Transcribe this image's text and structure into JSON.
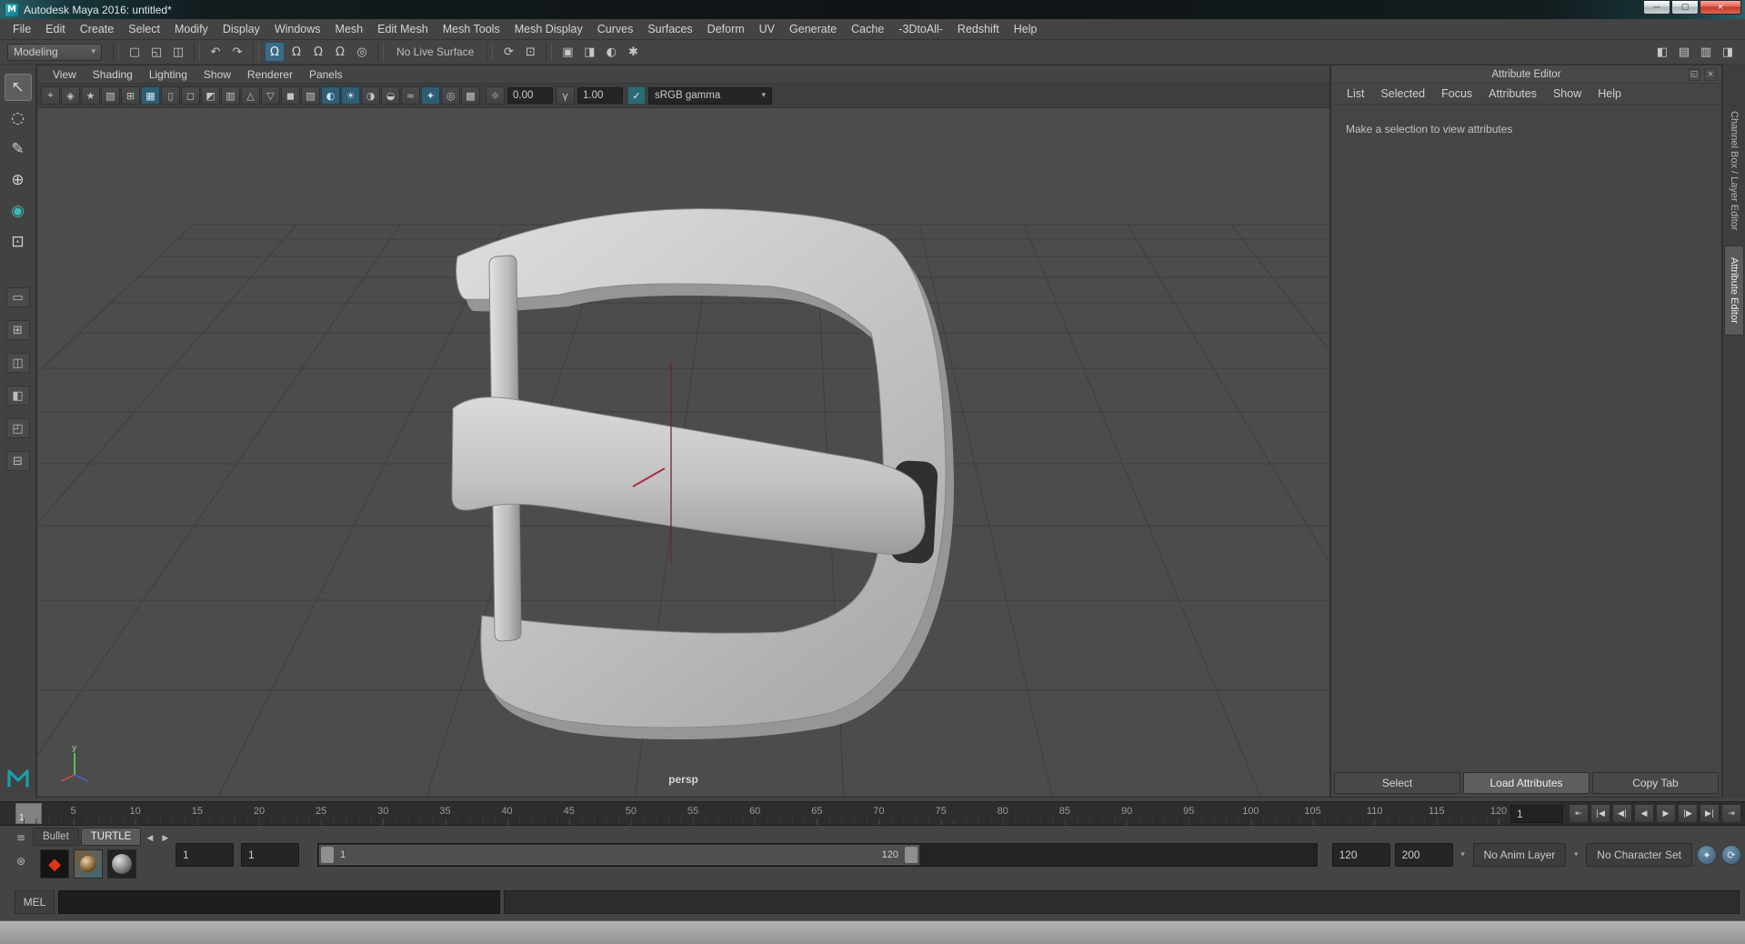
{
  "colors": {
    "accent_blue": "#3c6b86",
    "viewport_active_teal": "#2f5d74",
    "close_red": "#c23b28",
    "maya_teal": "#19a0a8",
    "viewport_bg": "#4c4c4c",
    "timeline_bg": "#2d2d2d"
  },
  "window": {
    "title": "Autodesk Maya 2016: untitled*",
    "controls": [
      {
        "name": "minimize-button",
        "glyph": "—"
      },
      {
        "name": "maximize-button",
        "glyph": "▢"
      },
      {
        "name": "close-button",
        "glyph": "×"
      }
    ]
  },
  "menu_bar": {
    "items": [
      "File",
      "Edit",
      "Create",
      "Select",
      "Modify",
      "Display",
      "Windows",
      "Mesh",
      "Edit Mesh",
      "Mesh Tools",
      "Mesh Display",
      "Curves",
      "Surfaces",
      "Deform",
      "UV",
      "Generate",
      "Cache",
      "-3DtoAll-",
      "Redshift",
      "Help"
    ]
  },
  "status_line": {
    "menuset": {
      "label": "Modeling"
    },
    "file_icons": [
      {
        "name": "new-scene-icon",
        "glyph": "▢"
      },
      {
        "name": "open-scene-icon",
        "glyph": "◱"
      },
      {
        "name": "save-scene-icon",
        "glyph": "◫"
      }
    ],
    "edit_icons": [
      {
        "name": "undo-icon",
        "glyph": "↶"
      },
      {
        "name": "redo-icon",
        "glyph": "↷"
      }
    ],
    "snap_icons": [
      {
        "name": "snap-to-grid-icon",
        "glyph": "Ω",
        "active": true
      },
      {
        "name": "snap-to-curves-icon",
        "glyph": "Ω"
      },
      {
        "name": "snap-to-points-icon",
        "glyph": "Ω"
      },
      {
        "name": "snap-to-view-plane-icon",
        "glyph": "Ω"
      },
      {
        "name": "make-live-icon",
        "glyph": "◎"
      }
    ],
    "no_live_surface": "No Live Surface",
    "history_icons": [
      {
        "name": "construction-history-icon",
        "glyph": "⟳"
      },
      {
        "name": "select-by-input-icon",
        "glyph": "⊡"
      }
    ],
    "render_icons": [
      {
        "name": "open-render-view-icon",
        "glyph": "▣"
      },
      {
        "name": "render-current-frame-icon",
        "glyph": "◨"
      },
      {
        "name": "ipr-render-icon",
        "glyph": "◐"
      },
      {
        "name": "render-settings-icon",
        "glyph": "✱"
      }
    ],
    "sidebar_icons": [
      {
        "name": "show-attribute-editor-icon",
        "glyph": "◧"
      },
      {
        "name": "show-tool-settings-icon",
        "glyph": "▤"
      },
      {
        "name": "show-channel-box-icon",
        "glyph": "▥"
      },
      {
        "name": "show-modeling-toolkit-icon",
        "glyph": "◨"
      }
    ]
  },
  "toolbox": {
    "tools": [
      {
        "name": "select-tool",
        "glyph": "↖",
        "active": true
      },
      {
        "name": "lasso-tool",
        "glyph": "◌"
      },
      {
        "name": "paint-select-tool",
        "glyph": "✎"
      },
      {
        "name": "move-tool",
        "glyph": "⊕"
      },
      {
        "name": "rotate-tool",
        "glyph": "◉",
        "color": "#3fb5b5"
      },
      {
        "name": "scale-tool",
        "glyph": "⊡"
      }
    ],
    "layouts": [
      {
        "name": "single-pane-layout-button",
        "glyph": "▭"
      },
      {
        "name": "four-pane-layout-button",
        "glyph": "⊞"
      },
      {
        "name": "persp-outliner-layout-button",
        "glyph": "◫"
      },
      {
        "name": "side-by-side-layout-button",
        "glyph": "◧"
      },
      {
        "name": "hypershade-layout-button",
        "glyph": "◰"
      },
      {
        "name": "stacked-layout-button",
        "glyph": "⊟"
      }
    ]
  },
  "viewport": {
    "panel_menu": [
      "View",
      "Shading",
      "Lighting",
      "Show",
      "Renderer",
      "Panels"
    ],
    "toolbar_icons": [
      {
        "name": "select-camera-icon",
        "glyph": "⌖"
      },
      {
        "name": "lock-camera-icon",
        "glyph": "◈"
      },
      {
        "name": "camera-attributes-icon",
        "glyph": "★"
      },
      {
        "name": "image-plane-icon",
        "glyph": "▧"
      },
      {
        "name": "two-d-pan-zoom-icon",
        "glyph": "⊞"
      },
      {
        "name": "grid-icon",
        "glyph": "▦",
        "active": true
      },
      {
        "name": "film-gate-icon",
        "glyph": "▯"
      },
      {
        "name": "resolution-gate-icon",
        "glyph": "◻"
      },
      {
        "name": "gate-mask-icon",
        "glyph": "◩"
      },
      {
        "name": "field-chart-icon",
        "glyph": "▥"
      },
      {
        "name": "safe-action-icon",
        "glyph": "△"
      },
      {
        "name": "safe-title-icon",
        "glyph": "▽"
      },
      {
        "name": "shaded-mode-icon",
        "glyph": "◼"
      },
      {
        "name": "wireframe-on-shaded-icon",
        "glyph": "▨"
      },
      {
        "name": "textured-mode-icon",
        "glyph": "◐",
        "active": true
      },
      {
        "name": "use-all-lights-icon",
        "glyph": "☀",
        "active": true
      },
      {
        "name": "shadows-icon",
        "glyph": "◑"
      },
      {
        "name": "ssao-icon",
        "glyph": "◒"
      },
      {
        "name": "motion-blur-icon",
        "glyph": "≈"
      },
      {
        "name": "multisample-aa-icon",
        "glyph": "✦",
        "active": true
      },
      {
        "name": "isolate-select-icon",
        "glyph": "◎"
      },
      {
        "name": "xray-icon",
        "glyph": "▩"
      }
    ],
    "exposure_icon": "☼",
    "exposure_label": "0.00",
    "gamma_icon": "γ",
    "gamma_label": "1.00",
    "color_management_icon": "✓",
    "view_transform": "sRGB gamma",
    "dropdown_arrow": "▾",
    "camera_label": "persp"
  },
  "attribute_editor": {
    "title": "Attribute Editor",
    "header_icons": [
      {
        "name": "ae-float-icon",
        "glyph": "◱"
      },
      {
        "name": "ae-close-icon",
        "glyph": "×"
      }
    ],
    "menu": [
      "List",
      "Selected",
      "Focus",
      "Attributes",
      "Show",
      "Help"
    ],
    "message": "Make a selection to view attributes",
    "buttons": [
      {
        "name": "select-button",
        "label": "Select"
      },
      {
        "name": "load-attributes-button",
        "label": "Load Attributes",
        "active": true
      },
      {
        "name": "copy-tab-button",
        "label": "Copy Tab"
      }
    ]
  },
  "side_tabs": [
    {
      "name": "tab-channel-box-layer-editor",
      "label": "Channel Box / Layer Editor"
    },
    {
      "name": "tab-attribute-editor",
      "label": "Attribute Editor",
      "active": true
    }
  ],
  "time_slider": {
    "ticks": [
      5,
      10,
      15,
      20,
      25,
      30,
      35,
      40,
      45,
      50,
      55,
      60,
      65,
      70,
      75,
      80,
      85,
      90,
      95,
      100,
      105,
      110,
      115,
      120
    ],
    "current_frame": "1",
    "frame_field": "1",
    "playback_buttons": [
      {
        "name": "go-to-start-button",
        "glyph": "⇤"
      },
      {
        "name": "step-back-frame-button",
        "glyph": "|◀"
      },
      {
        "name": "step-back-key-button",
        "glyph": "◀|"
      },
      {
        "name": "play-backwards-button",
        "glyph": "◀"
      },
      {
        "name": "play-forwards-button",
        "glyph": "▶"
      },
      {
        "name": "step-forward-key-button",
        "glyph": "|▶"
      },
      {
        "name": "step-forward-frame-button",
        "glyph": "▶|"
      },
      {
        "name": "go-to-end-button",
        "glyph": "⇥"
      }
    ]
  },
  "range_slider": {
    "animation_start": "1",
    "playback_start": "1",
    "range_bar_start_label": "1",
    "range_bar_end_label": "120",
    "playback_end": "120",
    "animation_end": "200",
    "anim_layer_button": "No Anim Layer",
    "character_set_button": "No Character Set",
    "left_icons": [
      {
        "name": "playback-options-icon",
        "glyph": "≡"
      },
      {
        "name": "animation-key-settings-icon",
        "glyph": "⊛"
      }
    ],
    "right_icons": [
      {
        "name": "auto-key-icon",
        "glyph": "✦"
      },
      {
        "name": "animation-preferences-icon",
        "glyph": "⟳"
      }
    ]
  },
  "plugin_area": {
    "tabs": [
      {
        "name": "tab-bullet",
        "label": "Bullet"
      },
      {
        "name": "tab-turtle",
        "label": "TURTLE",
        "active": true
      }
    ],
    "thumbnails": [
      {
        "name": "redshift-thumbnail",
        "glyph": "◆"
      },
      {
        "name": "turtle-thumbnail",
        "glyph": ""
      },
      {
        "name": "sphere-thumbnail",
        "glyph": ""
      }
    ]
  },
  "command_line": {
    "label": "MEL"
  }
}
